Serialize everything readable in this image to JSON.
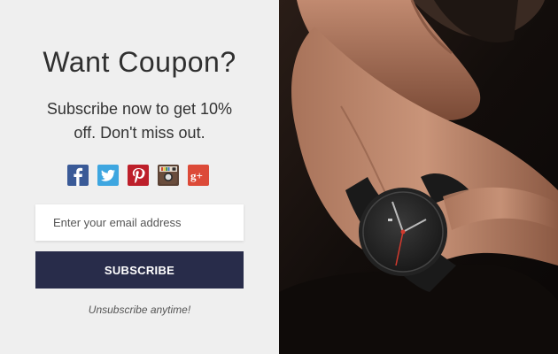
{
  "popup": {
    "title": "Want Coupon?",
    "description": "Subscribe now to get 10% off. Don't miss out.",
    "social_icons": [
      "facebook-icon",
      "twitter-icon",
      "pinterest-icon",
      "instagram-icon",
      "google-plus-icon"
    ],
    "email_placeholder": "Enter your email address",
    "email_value": "",
    "subscribe_label": "SUBSCRIBE",
    "unsubscribe_text": "Unsubscribe anytime!"
  },
  "colors": {
    "background": "#efefef",
    "button": "#282c4a",
    "facebook": "#3a5a97",
    "twitter": "#3ea6e0",
    "pinterest": "#bd1f2a",
    "instagram": "#5b4234",
    "google_plus": "#dc4a38"
  }
}
